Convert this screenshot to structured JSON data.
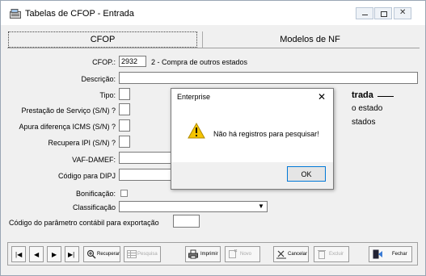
{
  "window": {
    "title": "Tabelas de CFOP - Entrada",
    "buttons": [
      "minimize",
      "maximize",
      "close"
    ]
  },
  "tabs": [
    {
      "label": "CFOP"
    },
    {
      "label": "Modelos de NF"
    }
  ],
  "form": {
    "cfop_label": "CFOP.:",
    "cfop_value": "2932",
    "cfop_desc": "2 - Compra de outros estados",
    "descricao_label": "Descrição:",
    "tipo_label": "Tipo:",
    "prestacao_label": "Prestação de Serviço (S/N) ?",
    "apura_label": "Apura diferença ICMS (S/N) ?",
    "recupera_label": "Recupera IPI (S/N) ?",
    "vaf_label": "VAF-DAMEF:",
    "dipj_label": "Código para DIPJ",
    "bonificacao_label": "Bonificação:",
    "classificacao_label": "Classificação",
    "codigo_param_label": "Código do parâmetro contábil para exportação",
    "bg_text_1": "trada",
    "bg_text_2": "o estado",
    "bg_text_3": "stados"
  },
  "dialog": {
    "title": "Enterprise",
    "message": "Não há registros para pesquisar!",
    "ok_label": "OK"
  },
  "toolbar": {
    "recuperar": "Recuperar",
    "pesquisa": "Pesquisa",
    "imprimir": "Imprimir",
    "novo": "Novo",
    "cancelar": "Cancelar",
    "excluir": "Excluir",
    "fechar": "Fechar"
  },
  "colors": {
    "accent": "#0078d7",
    "warning": "#f5c400"
  }
}
